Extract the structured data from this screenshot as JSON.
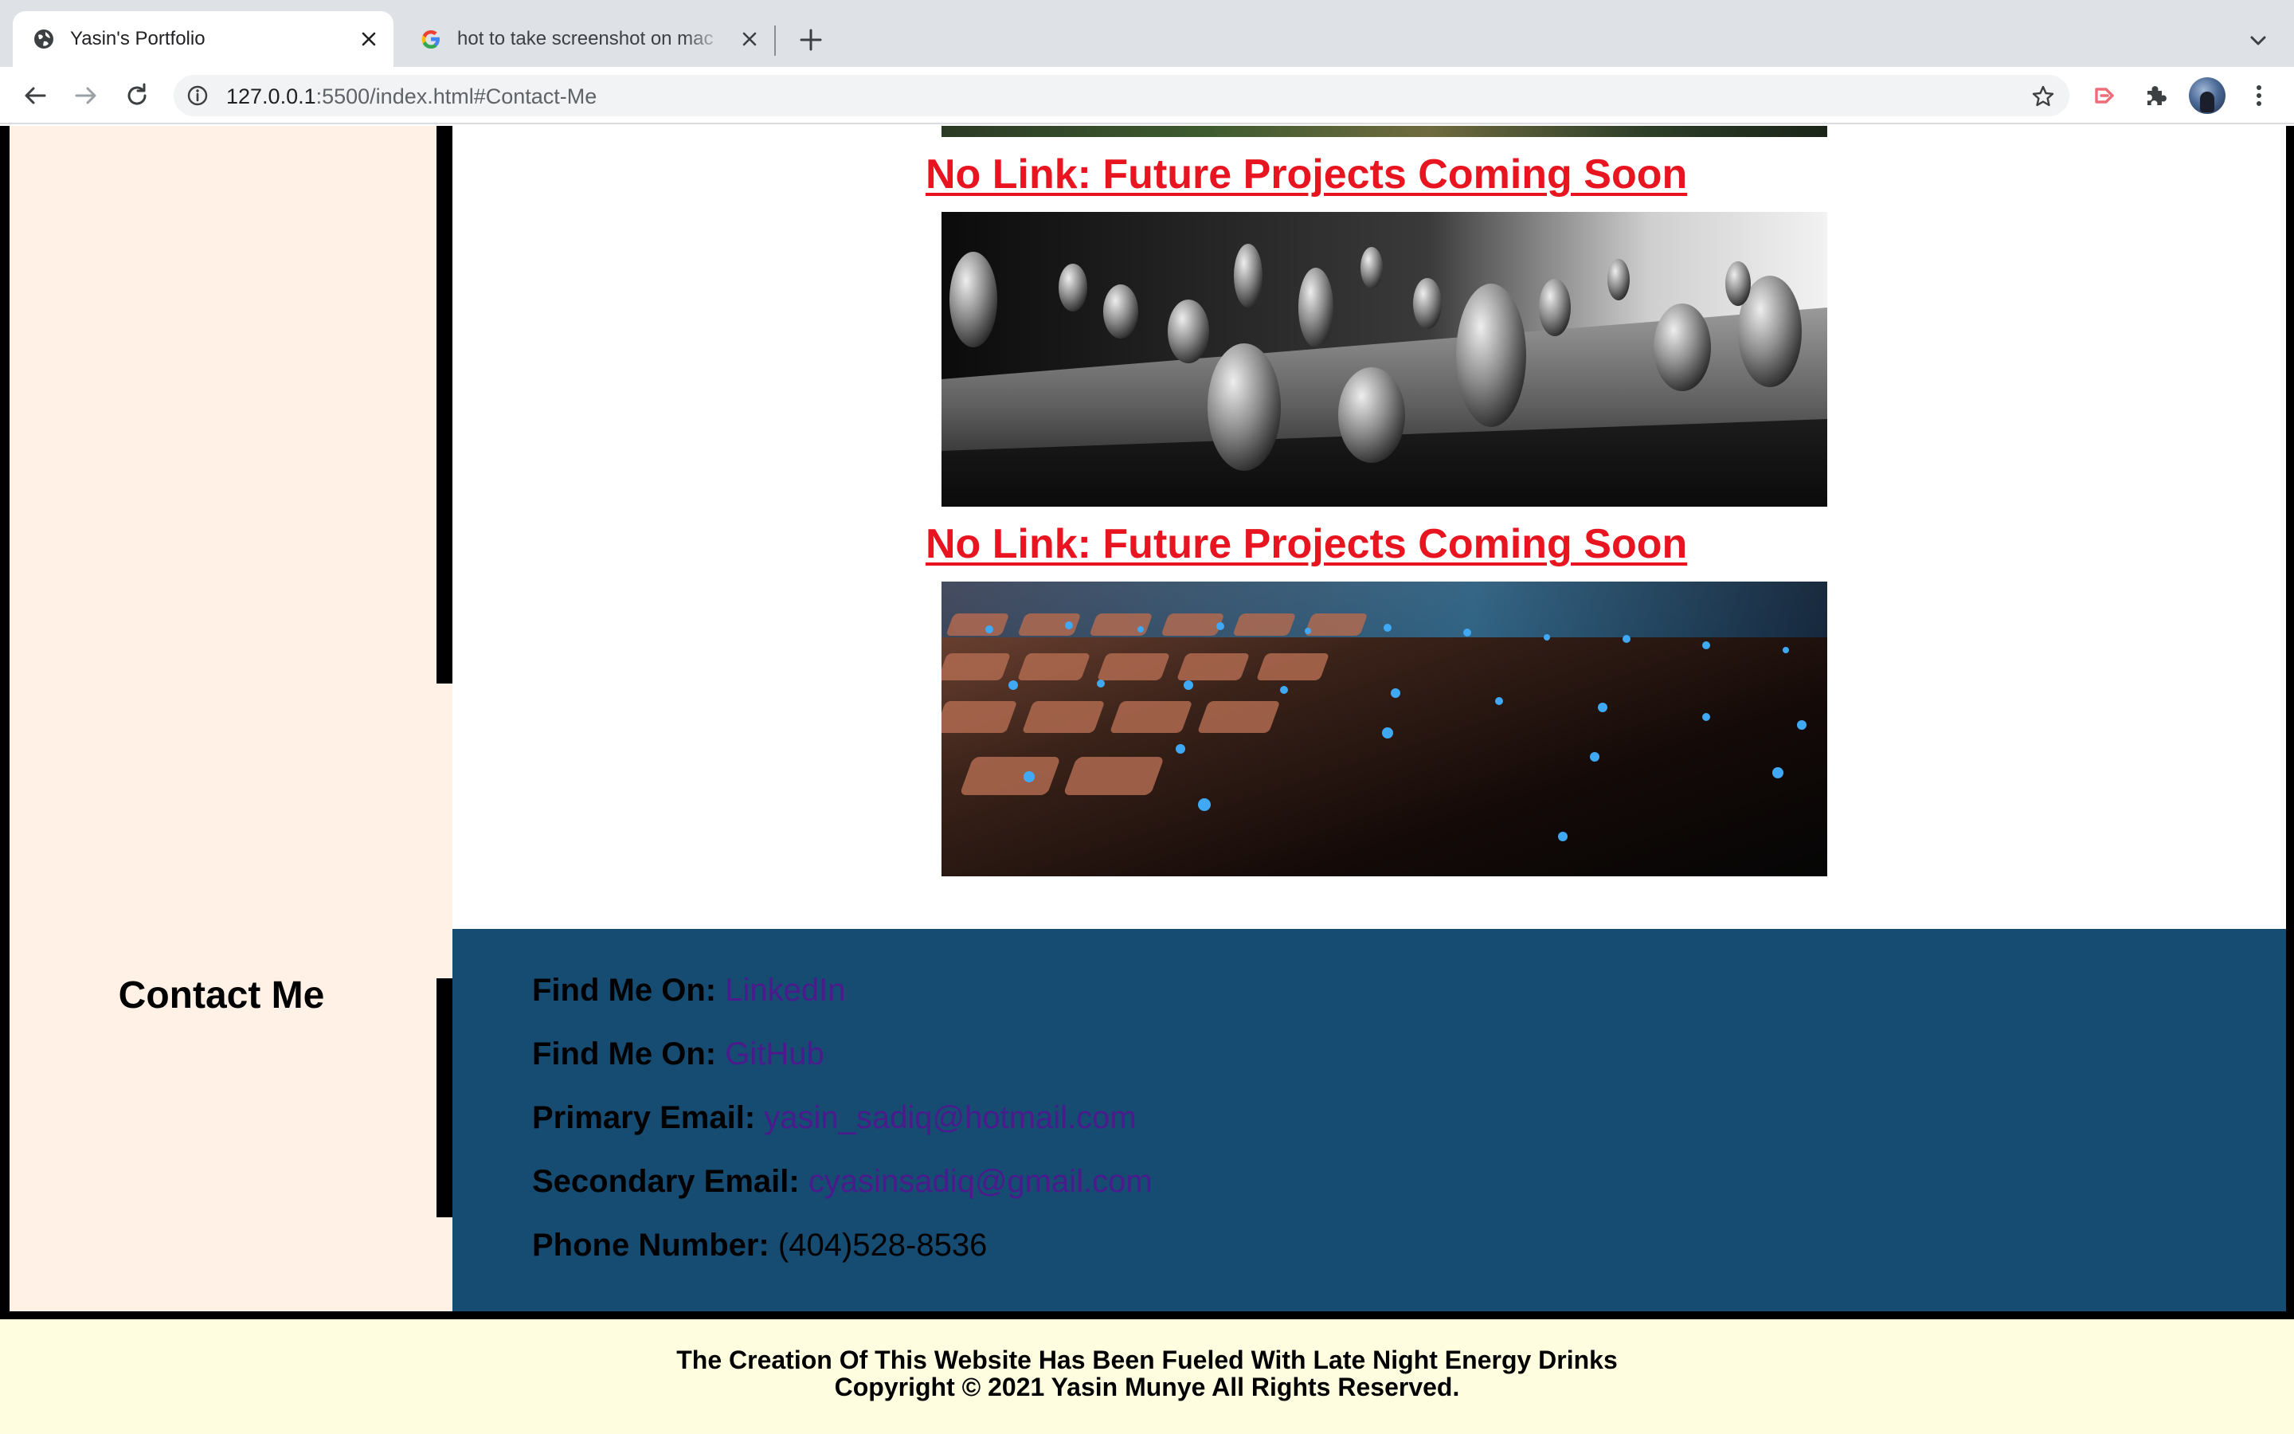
{
  "browser": {
    "tabs": [
      {
        "title": "Yasin's Portfolio",
        "active": true
      },
      {
        "title": "hot to take screenshot on mac",
        "active": false
      }
    ],
    "url": {
      "host": "127.0.0.1",
      "rest": ":5500/index.html#Contact-Me"
    }
  },
  "projects": [
    {
      "title": "No Link: Future Projects Coming Soon"
    },
    {
      "title": "No Link: Future Projects Coming Soon"
    }
  ],
  "sidebar": {
    "contact_heading": "Contact Me"
  },
  "contact": {
    "rows": [
      {
        "label": "Find Me On:",
        "value": "LinkedIn",
        "is_link": true
      },
      {
        "label": "Find Me On:",
        "value": "GitHub",
        "is_link": true
      },
      {
        "label": "Primary Email:",
        "value": "yasin_sadiq@hotmail.com",
        "is_link": true
      },
      {
        "label": "Secondary Email:",
        "value": "cyasinsadiq@gmail.com",
        "is_link": true
      },
      {
        "label": "Phone Number:",
        "value": "(404)528-8536",
        "is_link": false
      }
    ]
  },
  "footer": {
    "line1": "The Creation Of This Website Has Been Fueled With Late Night Energy Drinks",
    "line2": "Copyright © 2021 Yasin Munye All Rights Reserved."
  },
  "colors": {
    "sidebar_bg": "#fff1e6",
    "contact_bg": "#164b72",
    "project_title": "#e8141f",
    "link": "#4b1a8c",
    "footer_bg": "#fffde0"
  }
}
